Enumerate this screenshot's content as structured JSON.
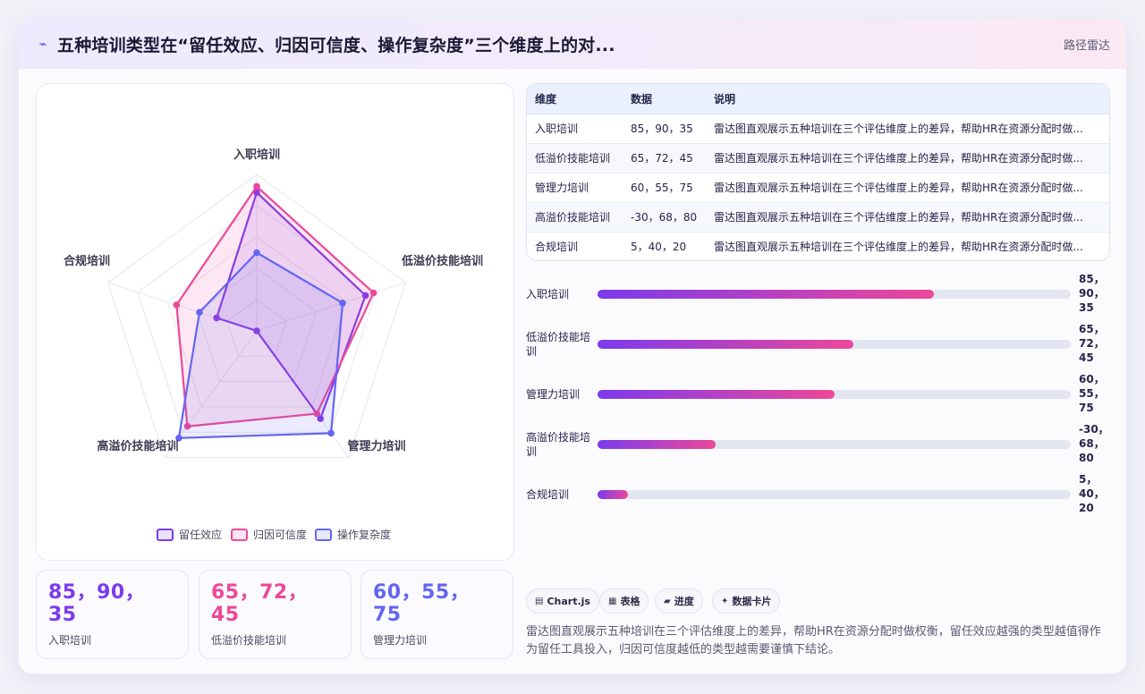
{
  "header": {
    "title": "五种培训类型在“留任效应、归因可信度、操作复杂度”三个维度上的对...",
    "mode": "路径雷达"
  },
  "colors": {
    "series1": "#7c3aed",
    "series2": "#ec4899",
    "series3": "#6366f1",
    "grid": "#e6e7ef"
  },
  "chart_data": {
    "type": "radar",
    "axes": [
      "入职培训",
      "低溢价技能培训",
      "管理力培训",
      "高溢价技能培训",
      "合规培训"
    ],
    "range": [
      -30,
      100
    ],
    "series": [
      {
        "name": "留任效应",
        "values": [
          85,
          65,
          60,
          -30,
          5
        ]
      },
      {
        "name": "归因可信度",
        "values": [
          90,
          72,
          55,
          68,
          40
        ]
      },
      {
        "name": "操作复杂度",
        "values": [
          35,
          45,
          75,
          80,
          20
        ]
      }
    ],
    "legend": "bottom",
    "grid": true
  },
  "table": {
    "headers": [
      "维度",
      "数据",
      "说明"
    ],
    "rows": [
      {
        "dim": "入职培训",
        "data": "85，90，35",
        "note": "雷达图直观展示五种培训在三个评估维度上的差异，帮助HR在资源分配时做..."
      },
      {
        "dim": "低溢价技能培训",
        "data": "65，72，45",
        "note": "雷达图直观展示五种培训在三个评估维度上的差异，帮助HR在资源分配时做..."
      },
      {
        "dim": "管理力培训",
        "data": "60，55，75",
        "note": "雷达图直观展示五种培训在三个评估维度上的差异，帮助HR在资源分配时做..."
      },
      {
        "dim": "高溢价技能培训",
        "data": "-30，68，80",
        "note": "雷达图直观展示五种培训在三个评估维度上的差异，帮助HR在资源分配时做..."
      },
      {
        "dim": "合规培训",
        "data": "5，40，20",
        "note": "雷达图直观展示五种培训在三个评估维度上的差异，帮助HR在资源分配时做..."
      }
    ]
  },
  "progress": [
    {
      "label": "入职培训",
      "value_lines": [
        "85，",
        "90，",
        "35"
      ],
      "fraction": 0.71
    },
    {
      "label": "低溢价技能培训",
      "value_lines": [
        "65，",
        "72，",
        "45"
      ],
      "fraction": 0.54
    },
    {
      "label": "管理力培训",
      "value_lines": [
        "60，",
        "55，",
        "75"
      ],
      "fraction": 0.5
    },
    {
      "label": "高溢价技能培训",
      "value_lines": [
        "-30，",
        "68，",
        "80"
      ],
      "fraction": 0.25
    },
    {
      "label": "合规培训",
      "value_lines": [
        "5，",
        "40，",
        "20"
      ],
      "fraction": 0.065
    }
  ],
  "stats": [
    {
      "value_line1": "85，90，",
      "value_line2": "35",
      "label": "入职培训",
      "color": "#7c3aed"
    },
    {
      "value_line1": "65，72，",
      "value_line2": "45",
      "label": "低溢价技能培训",
      "color": "#ec4899"
    },
    {
      "value_line1": "60，55，",
      "value_line2": "75",
      "label": "管理力培训",
      "color": "#6366f1"
    }
  ],
  "chips": [
    {
      "icon": "▤",
      "icon_name": "chart-icon",
      "label": "Chart.js"
    },
    {
      "icon": "▦",
      "icon_name": "table-icon",
      "label": "表格"
    },
    {
      "icon": "▰",
      "icon_name": "progress-icon",
      "label": "进度"
    },
    {
      "icon": "✦",
      "icon_name": "card-icon",
      "label": "数据卡片"
    }
  ],
  "description": "雷达图直观展示五种培训在三个评估维度上的差异，帮助HR在资源分配时做权衡，留任效应越强的类型越值得作为留任工具投入，归因可信度越低的类型越需要谨慎下结论。"
}
